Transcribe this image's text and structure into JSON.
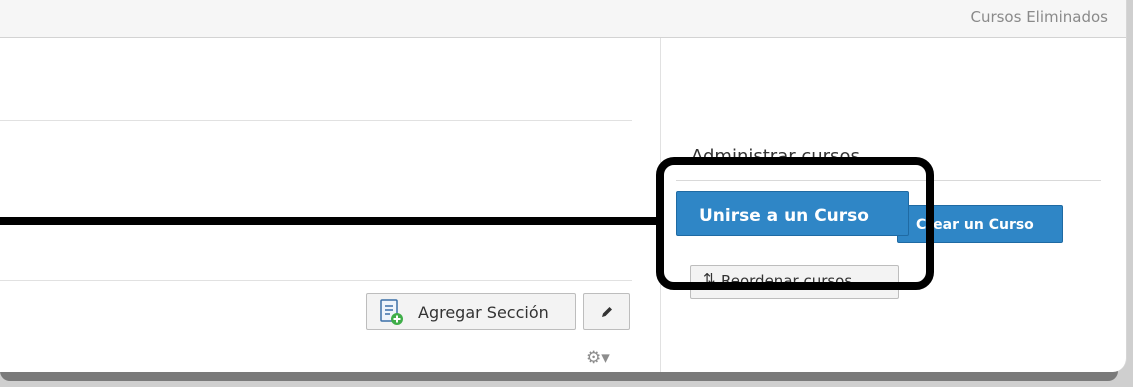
{
  "header": {
    "deleted_courses_link": "Cursos Eliminados"
  },
  "sidebar": {
    "heading": "Administrar cursos",
    "join_course_button": "Unirse a un Curso",
    "create_course_button": "Crear un Curso",
    "reorder_courses_button": "Reordenar cursos"
  },
  "main": {
    "add_section_button": "Agregar Sección"
  },
  "icons": {
    "add_section": "notebook-add-icon",
    "edit": "pencil-icon",
    "settings": "gear-dropdown-icon",
    "reorder": "up-down-arrows-icon"
  },
  "colors": {
    "primary_button": "#2f86c6",
    "callout": "#000000"
  }
}
